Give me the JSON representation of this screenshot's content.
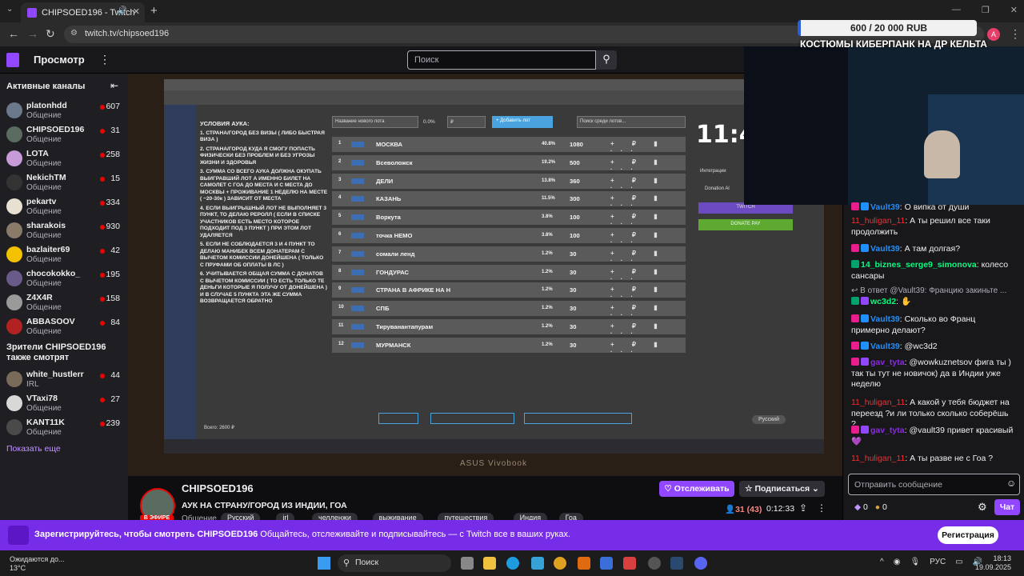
{
  "browser": {
    "tab_title": "CHIPSOED196 - Twitch",
    "url": "twitch.tv/chipsoed196",
    "profile_letter": "A"
  },
  "twitch_nav": {
    "browse": "Просмотр",
    "search_placeholder": "Поиск"
  },
  "sidebar": {
    "active_heading": "Активные каналы",
    "channels": [
      {
        "name": "platonhdd",
        "category": "Общение",
        "viewers": "607",
        "color": "#6a7a8c"
      },
      {
        "name": "CHIPSOED196",
        "category": "Общение",
        "viewers": "31",
        "color": "#5a6b5f"
      },
      {
        "name": "LOTA",
        "category": "Общение",
        "viewers": "258",
        "color": "#c79bd8"
      },
      {
        "name": "NekichTM",
        "category": "Общение",
        "viewers": "15",
        "color": "#333333"
      },
      {
        "name": "pekartv",
        "category": "Общение",
        "viewers": "334",
        "color": "#e8e0d0"
      },
      {
        "name": "sharakois",
        "category": "Общение",
        "viewers": "930",
        "color": "#8a7a6a"
      },
      {
        "name": "bazlaiter69",
        "category": "Общение",
        "viewers": "42",
        "color": "#f2c200"
      },
      {
        "name": "chocokokko_",
        "category": "Общение",
        "viewers": "195",
        "color": "#6a5a8a"
      },
      {
        "name": "Z4X4R",
        "category": "Общение",
        "viewers": "158",
        "color": "#9a9a9a"
      },
      {
        "name": "ABBASOOV",
        "category": "Общение",
        "viewers": "84",
        "color": "#b22222"
      }
    ],
    "viewers_heading": "Зрители CHIPSOED196 также смотрят",
    "also_watch": [
      {
        "name": "white_hustlerr",
        "category": "IRL",
        "viewers": "44",
        "color": "#7a6a5a"
      },
      {
        "name": "VTaxi78",
        "category": "Общение",
        "viewers": "27",
        "color": "#d8d8d8"
      },
      {
        "name": "KANT11K",
        "category": "Общение",
        "viewers": "239",
        "color": "#4a4a4a"
      }
    ],
    "show_more": "Показать еще"
  },
  "stream_video": {
    "conditions_title": "УСЛОВИЯ АУКА:",
    "conditions": [
      "1. СТРАНА/ГОРОД БЕЗ ВИЗЫ ( ЛИБО БЫСТРАЯ ВИЗА )",
      "2. СТРАНА/ГОРОД КУДА Я СМОГУ ПОПАСТЬ ФИЗИЧЕСКИ БЕЗ ПРОБЛЕМ И БЕЗ УГРОЗЫ ЖИЗНИ И ЗДОРОВЬЯ",
      "3. СУММА СО ВСЕГО АУКА ДОЛЖНА ОКУПАТЬ ВЫИГРАВШИЙ ЛОТ А ИМЕННО БИЛЕТ НА САМОЛЕТ С ГОА ДО МЕСТА И С МЕСТА ДО МОСКВЫ + ПРОЖИВАНИЕ 1 НЕДЕЛЮ НА МЕСТЕ ( ~20-30к ) ЗАВИСИТ ОТ МЕСТА",
      "4. ЕСЛИ ВЫИГРЫШНЫЙ ЛОТ НЕ ВЫПОЛНЯЕТ 3 ПУНКТ, ТО ДЕЛАЮ РЕРОЛЛ ( ЕСЛИ В СПИСКЕ УЧАСТНИКОВ ЕСТЬ МЕСТО КОТОРОЕ ПОДХОДИТ ПОД 3 ПУНКТ ) ПРИ ЭТОМ ЛОТ УДАЛЯЕТСЯ",
      "5. ЕСЛИ НЕ СОБЛЮДАЕТСЯ 3 И 4 ПУНКТ ТО ДЕЛАЮ МАНИБЕК ВСЕМ ДОНАТЕРАМ С ВЫЧЕТОМ КОМИССИИ ДОНЕЙШЕНА ( ТОЛЬКО С ПРУФАМИ ОБ ОПЛАТЫ В ЛС )",
      "6. УЧИТЫВАЕТСЯ ОБЩАЯ СУММА С ДОНАТОВ С ВЫЧЕТОМ КОМИССИИ ( ТО ЕСТЬ ТОЛЬКО ТЕ ДЕНЬГИ КОТОРЫЕ Я ПОЛУЧУ ОТ ДОНЕЙШЕНА ) И В СЛУЧАЕ 5 ПУНКТА ЭТА ЖЕ СУММА ВОЗВРАЩАЕТСЯ ОБРАТНО"
    ],
    "lot_name_placeholder": "Название нового лота",
    "lot_percent": "0.0%",
    "lot_currency": "₽",
    "add_lot_label": "+ Добавить лот",
    "search_lots_placeholder": "Поиск среди лотов...",
    "lots": [
      {
        "n": "1",
        "name": "МОСКВА",
        "pct": "40.8%",
        "amount": "1080"
      },
      {
        "n": "2",
        "name": "Всеволожск",
        "pct": "19.2%",
        "amount": "500"
      },
      {
        "n": "3",
        "name": "ДЕЛИ",
        "pct": "13.8%",
        "amount": "360"
      },
      {
        "n": "4",
        "name": "КАЗАНЬ",
        "pct": "11.5%",
        "amount": "300"
      },
      {
        "n": "5",
        "name": "Воркута",
        "pct": "3.8%",
        "amount": "100"
      },
      {
        "n": "6",
        "name": "точка НЕМО",
        "pct": "3.8%",
        "amount": "100"
      },
      {
        "n": "7",
        "name": "сомали ленд",
        "pct": "1.2%",
        "amount": "30"
      },
      {
        "n": "8",
        "name": "ГОНДУРАС",
        "pct": "1.2%",
        "amount": "30"
      },
      {
        "n": "9",
        "name": "СТРАНА В АФРИКЕ НА Н",
        "pct": "1.2%",
        "amount": "30"
      },
      {
        "n": "10",
        "name": "СПБ",
        "pct": "1.2%",
        "amount": "30"
      },
      {
        "n": "11",
        "name": "Тируванантапурам",
        "pct": "1.2%",
        "amount": "30"
      },
      {
        "n": "12",
        "name": "МУРМАНСК",
        "pct": "1.2%",
        "amount": "30"
      }
    ],
    "lot_icons": "+ ₽ ▮ ···",
    "total": "Всего: 2600 ₽",
    "timer": "11:4",
    "integrations_label": "Интеграции",
    "donation_label": "Donation Al",
    "twitch_btn": "TWITCH",
    "donate_btn": "DONATE PAY",
    "lang": "Русский",
    "laptop_brand": "ASUS Vivobook"
  },
  "overlay": {
    "goal": "600 / 20 000 RUB",
    "goal_title": "КОСТЮМЫ КИБЕРПАНК НА ДР КЕЛЬТА"
  },
  "chat": {
    "messages": [
      {
        "user": "Vault39",
        "text": "О випка от души",
        "style": "u-v",
        "badges": [
          "b-pink",
          "b-blue"
        ]
      },
      {
        "user": "11_huligan_11",
        "text": "А ты решил все таки продолжить",
        "style": "u-h",
        "badges": []
      },
      {
        "user": "Vault39",
        "text": "А там долгая?",
        "style": "u-v",
        "badges": [
          "b-pink",
          "b-blue"
        ]
      },
      {
        "user": "14_biznes_serge9_simonova",
        "text": "колесо сансары",
        "style": "u-b",
        "badges": [
          "b-grn"
        ]
      },
      {
        "user": "wc3d2",
        "text": "✋",
        "style": "u-b",
        "badges": [
          "b-grn",
          "b-pur"
        ],
        "reply": "В ответ @Vault39: Францию закиньте ..."
      },
      {
        "user": "Vault39",
        "text": "Сколько во Франц примерно делают?",
        "style": "u-v",
        "badges": [
          "b-pink",
          "b-blue"
        ]
      },
      {
        "user": "Vault39",
        "text": "@wc3d2",
        "style": "u-v",
        "badges": [
          "b-pink",
          "b-blue"
        ]
      },
      {
        "user": "gav_tyta",
        "text": "@wowkuznetsov фига ты ) так ты тут не новичок) да в Индии уже неделю",
        "style": "u-g",
        "badges": [
          "b-pink",
          "b-pur"
        ]
      },
      {
        "user": "11_huligan_11",
        "text": "А какой у тебя бюджет на переезд ?и ли только сколько соберёшь ?",
        "style": "u-h",
        "badges": []
      },
      {
        "user": "gav_tyta",
        "text": "@vault39 привет красивый💜",
        "style": "u-g",
        "badges": [
          "b-pink",
          "b-pur"
        ]
      },
      {
        "user": "11_huligan_11",
        "text": "А ты разве не с Гоа ?",
        "style": "u-h",
        "badges": []
      }
    ],
    "input_placeholder": "Отправить сообщение",
    "points_a": "0",
    "points_b": "0",
    "chat_button": "Чат"
  },
  "stream_info": {
    "name": "CHIPSOED196",
    "live": "В ЭФИРЕ",
    "title": "АУК НА СТРАНУ/ГОРОД ИЗ ИНДИИ, ГОА",
    "category": "Общение",
    "tags": [
      "Русский",
      "irl",
      "челленжи",
      "выживание",
      "путешествия",
      "Индия",
      "Гоа"
    ],
    "follow": "♡ Отслеживать",
    "subscribe": "☆ Подписаться ⌄",
    "viewers": "31 (43)",
    "uptime": "0:12:33"
  },
  "banner": {
    "bold": "Зарегистрируйтесь, чтобы смотреть CHIPSOED196",
    "text": "Общайтесь, отслеживайте и подписывайтесь — с Twitch все в ваших руках.",
    "register": "Регистрация"
  },
  "taskbar": {
    "weather_line1": "Ожидаются до...",
    "weather_line2": "13°C",
    "search": "Поиск",
    "lang": "РУС",
    "time": "18:13",
    "date": "19.09.2025"
  },
  "colors": {
    "twitch_purple": "#9146ff",
    "live_red": "#eb0400",
    "banner": "#772ce8"
  }
}
